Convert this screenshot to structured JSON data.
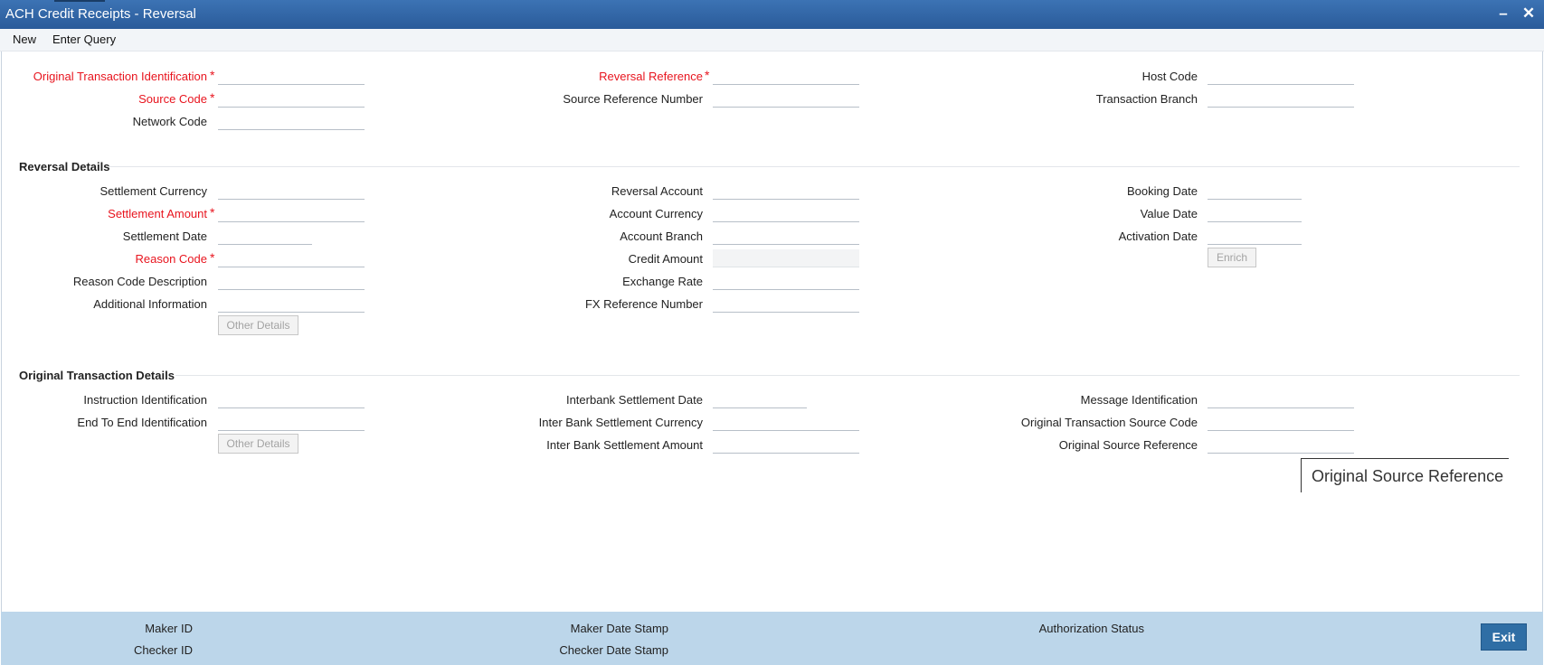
{
  "window": {
    "title": "ACH Credit Receipts - Reversal",
    "minimize": "–",
    "close": "✕"
  },
  "menu": {
    "new": "New",
    "enter_query": "Enter Query"
  },
  "header": {
    "original_transaction_identification": "Original Transaction Identification",
    "source_code": "Source Code",
    "network_code": "Network Code",
    "reversal_reference": "Reversal Reference",
    "source_reference_number": "Source Reference Number",
    "host_code": "Host Code",
    "transaction_branch": "Transaction Branch",
    "required_mark": "*"
  },
  "reversal": {
    "title": "Reversal Details",
    "settlement_currency": "Settlement Currency",
    "settlement_amount": "Settlement Amount",
    "settlement_date": "Settlement Date",
    "reason_code": "Reason Code",
    "reason_code_description": "Reason Code Description",
    "additional_information": "Additional Information",
    "other_details": "Other Details",
    "reversal_account": "Reversal Account",
    "account_currency": "Account Currency",
    "account_branch": "Account Branch",
    "credit_amount": "Credit Amount",
    "exchange_rate": "Exchange Rate",
    "fx_reference_number": "FX Reference Number",
    "booking_date": "Booking Date",
    "value_date": "Value Date",
    "activation_date": "Activation Date",
    "enrich": "Enrich"
  },
  "original": {
    "title": "Original Transaction Details",
    "instruction_identification": "Instruction Identification",
    "end_to_end_identification": "End To End Identification",
    "other_details": "Other Details",
    "interbank_settlement_date": "Interbank Settlement Date",
    "inter_bank_settlement_currency": "Inter Bank Settlement Currency",
    "inter_bank_settlement_amount": "Inter Bank Settlement Amount",
    "message_identification": "Message Identification",
    "original_transaction_source_code": "Original Transaction Source Code",
    "original_source_reference": "Original Source Reference"
  },
  "tooltip": {
    "text": "Original Source Reference"
  },
  "footer": {
    "maker_id": "Maker ID",
    "checker_id": "Checker ID",
    "maker_date_stamp": "Maker Date Stamp",
    "checker_date_stamp": "Checker Date Stamp",
    "authorization_status": "Authorization Status",
    "exit": "Exit"
  }
}
